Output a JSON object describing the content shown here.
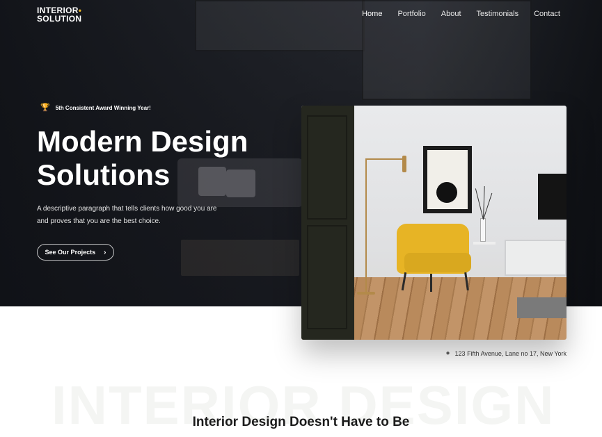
{
  "brand": {
    "line1": "INTERIOR",
    "dot": "•",
    "line2": "SOLUTION",
    "accent_color": "#e7b425"
  },
  "nav": {
    "items": [
      {
        "label": "Home",
        "active": true
      },
      {
        "label": "Portfolio",
        "active": false
      },
      {
        "label": "About",
        "active": false
      },
      {
        "label": "Testimonials",
        "active": false
      },
      {
        "label": "Contact",
        "active": false
      }
    ]
  },
  "hero": {
    "award_icon": "trophy-icon",
    "award_text": "5th Consistent Award Winning Year!",
    "headline_line1": "Modern Design",
    "headline_line2": "Solutions",
    "description": "A descriptive paragraph that tells clients how good you are and proves that you are the best choice.",
    "cta_label": "See Our Projects",
    "cta_icon": "chevron-right-icon"
  },
  "address": {
    "icon": "map-pin-icon",
    "text": "123 Fifth Avenue, Lane no 17, New York"
  },
  "about": {
    "watermark": "INTERIOR DESIGN",
    "title_visible": "Interior Design Doesn't Have to Be"
  }
}
